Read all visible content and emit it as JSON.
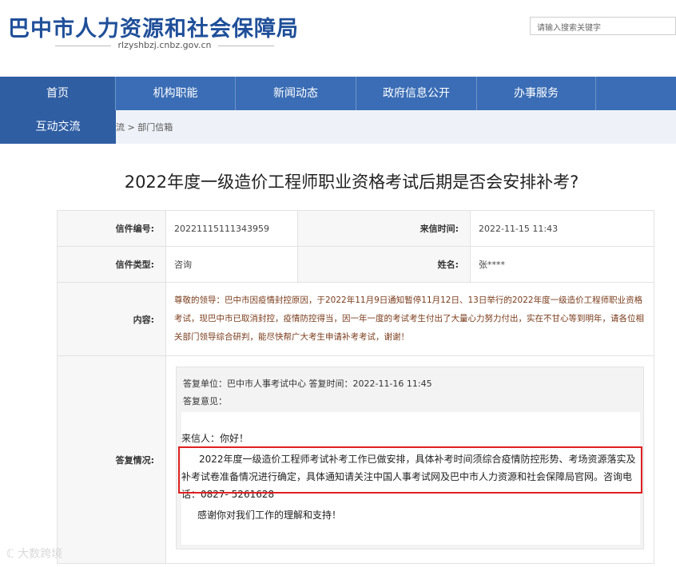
{
  "header": {
    "site_title": "巴中市人力资源和社会保障局",
    "site_domain": "rlzyshbzj.cnbz.gov.cn",
    "search_placeholder": "请输入搜索关键字"
  },
  "nav": {
    "items": [
      "首页",
      "机构职能",
      "新闻动态",
      "政府信息公开",
      "办事服务",
      "互动交流"
    ]
  },
  "breadcrumb": "流 > 部门信箱",
  "page_title": "2022年度一级造价工程师职业资格考试后期是否会安排补考?",
  "letter": {
    "number_label": "信件编号:",
    "number": "20221115111343959",
    "date_label": "来信时间:",
    "date": "2022-11-15 11:43",
    "type_label": "信件类型:",
    "type": "咨询",
    "name_label": "姓名:",
    "name": "张****",
    "content_label": "内容:",
    "content": "尊敬的领导：巴中市因疫情封控原因，于2022年11月9日通知暂停11月12日、13日举行的2022年度一级造价工程师职业资格考试，现巴中市已取消封控，疫情防控得当，因一年一度的考试考生付出了大量心力努力付出，实在不甘心等到明年，请各位相关部门领导综合研判，能尽快帮广大考生申请补考考试，谢谢！"
  },
  "reply": {
    "label": "答复情况:",
    "meta": "答复单位：巴中市人事考试中心    答复时间：2022-11-16 11:45",
    "opinion_label": "答复意见：",
    "greeting": "来信人：你好！",
    "body": "2022年度一级造价工程师考试补考工作已做安排，具体补考时间须综合疫情防控形势、考场资源落实及补考试卷准备情况进行确定，具体通知请关注中国人事考试网及巴中市人力资源和社会保障局官网。咨询电话：0827-  5261628",
    "thanks": "感谢你对我们工作的理解和支持！"
  },
  "watermark": "大数跨境"
}
